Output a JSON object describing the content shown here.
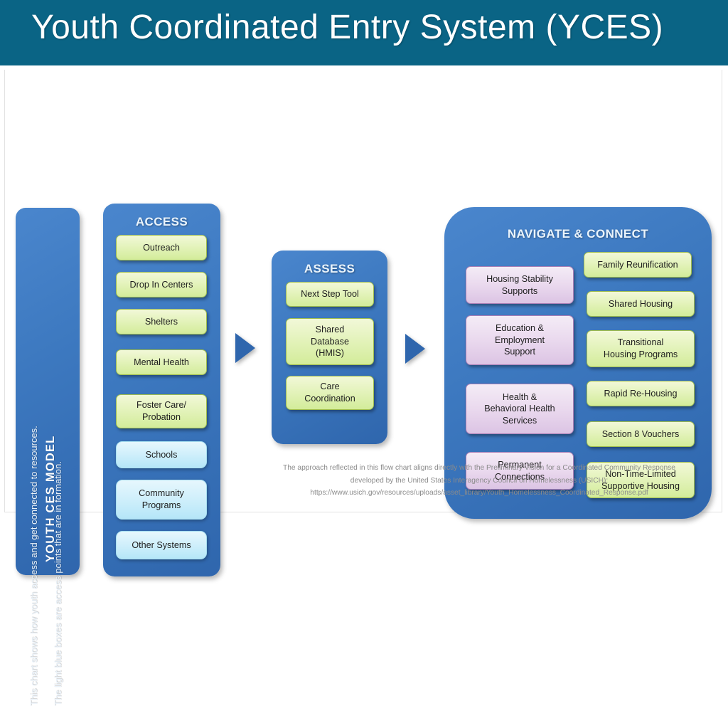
{
  "banner": {
    "title": "Youth Coordinated Entry System (YCES)",
    "background_color": "#0a6485"
  },
  "model_panel": {
    "title": "YOUTH  CES  MODEL",
    "description_line1": "This chart shows how youth access and get connected  to resources.",
    "description_line2": "The  light blue boxes are access points that are in formation.",
    "background_color": "#3d79c0"
  },
  "columns": {
    "access": {
      "heading": "ACCESS",
      "items": [
        {
          "label": "Outreach",
          "style": "green"
        },
        {
          "label": "Drop In Centers",
          "style": "green"
        },
        {
          "label": "Shelters",
          "style": "green"
        },
        {
          "label": "Mental Health",
          "style": "green"
        },
        {
          "label": "Foster Care/\nProbation",
          "style": "green"
        },
        {
          "label": "Schools",
          "style": "lightblue"
        },
        {
          "label": "Community\nPrograms",
          "style": "lightblue"
        },
        {
          "label": "Other Systems",
          "style": "lightblue"
        }
      ]
    },
    "assess": {
      "heading": "ASSESS",
      "items": [
        {
          "label": "Next Step Tool",
          "style": "green"
        },
        {
          "label": "Shared\nDatabase\n(HMIS)",
          "style": "green"
        },
        {
          "label": "Care\nCoordination",
          "style": "green"
        }
      ]
    },
    "navigate": {
      "heading": "NAVIGATE & CONNECT",
      "services": [
        {
          "label": "Housing Stability\nSupports",
          "style": "purple"
        },
        {
          "label": "Education &\nEmployment\nSupport",
          "style": "purple"
        },
        {
          "label": "Health &\nBehavioral Health\nServices",
          "style": "purple"
        },
        {
          "label": "Permanent\nConnections",
          "style": "purple"
        }
      ],
      "housing_options": [
        {
          "label": "Family Reunification",
          "style": "green"
        },
        {
          "label": "Shared Housing",
          "style": "green"
        },
        {
          "label": "Transitional\nHousing Programs",
          "style": "green"
        },
        {
          "label": "Rapid Re-Housing",
          "style": "green"
        },
        {
          "label": "Section 8 Vouchers",
          "style": "green"
        },
        {
          "label": "Non-Time-Limited\nSupportive Housing",
          "style": "green"
        }
      ]
    }
  },
  "arrows": [
    {
      "name": "access-to-assess",
      "direction": "right"
    },
    {
      "name": "assess-to-navigate",
      "direction": "right"
    }
  ],
  "footnote": {
    "line1": "The approach reflected in this flow chart aligns directly with the Preliminary Vision for a Coordinated Community Response",
    "line2": "developed by the United States Interagency Council on Homelessness (USICH):",
    "line3": "https://www.usich.gov/resources/uploads/asset_library/Youth_Homelessness_Coordinated_Response.pdf"
  },
  "colors": {
    "banner_teal": "#0a6485",
    "panel_blue": "#3d79c0",
    "node_green": "#dff0b4",
    "node_green_border": "#9fbd4e",
    "node_lightblue": "#cfeffb",
    "node_purple": "#e6d6ec",
    "node_purple_border": "#a97fb6",
    "arrow_blue": "#2f66ad"
  }
}
